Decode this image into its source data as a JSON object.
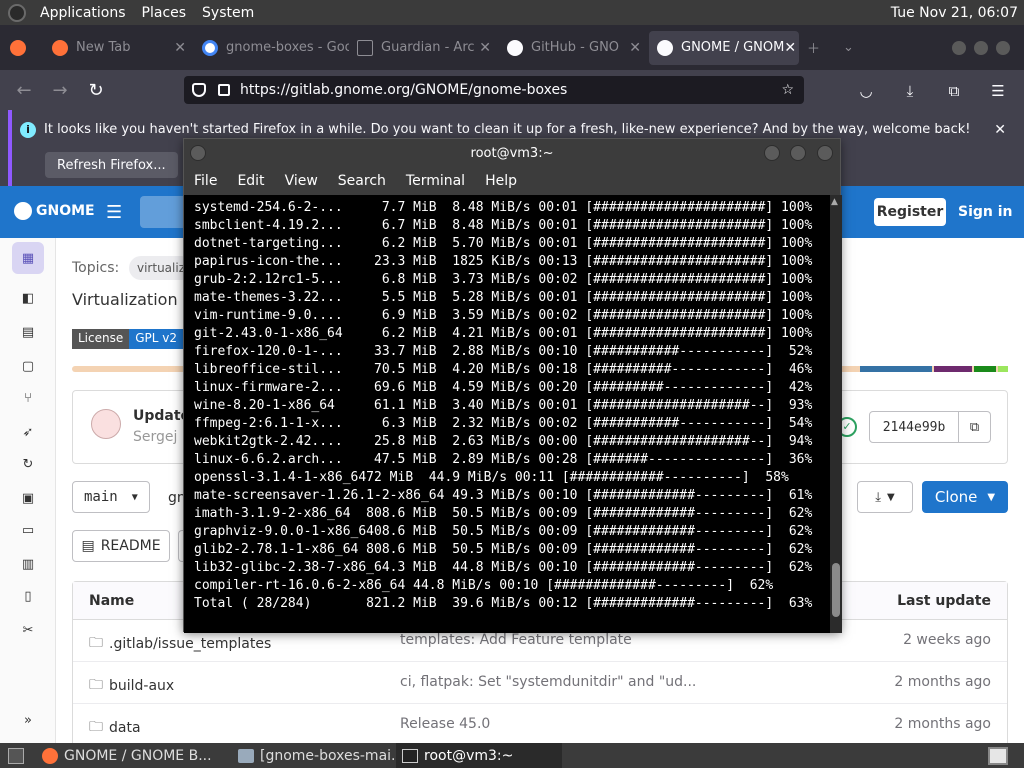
{
  "top_panel": {
    "menus": [
      "Applications",
      "Places",
      "System"
    ],
    "clock": "Tue Nov 21, 06:07"
  },
  "browser": {
    "tabs": [
      {
        "title": "New Tab",
        "active": false
      },
      {
        "title": "gnome-boxes - Goo",
        "active": false
      },
      {
        "title": "Guardian - Arc",
        "active": false
      },
      {
        "title": "GitHub - GNO",
        "active": false
      },
      {
        "title": "GNOME / GNOM",
        "active": true
      }
    ],
    "url": "https://gitlab.gnome.org/GNOME/gnome-boxes",
    "notification": {
      "message": "It looks like you haven't started Firefox in a while. Do you want to clean it up for a fresh, like-new experience? And by the way, welcome back!",
      "button": "Refresh Firefox..."
    }
  },
  "gitlab": {
    "logo_text": "GNOME",
    "register": "Register",
    "sign_in": "Sign in",
    "topics_label": "Topics:",
    "topic_chip": "virtualiz",
    "description": "Virtualization m",
    "license": {
      "label": "License",
      "value": "GPL v2"
    },
    "commit": {
      "title": "Update",
      "author": "Sergej",
      "sha": "2144e99b"
    },
    "branch": "main",
    "path_fragment": "gn",
    "clone_label": "Clone",
    "readme_label": "README",
    "file_table": {
      "col_name": "Name",
      "col_updated": "Last update",
      "rows": [
        {
          "name": ".gitlab/issue_templates",
          "commit": "templates: Add Feature template",
          "updated": "2 weeks ago"
        },
        {
          "name": "build-aux",
          "commit": "ci, flatpak: Set \"systemdunitdir\" and \"ud...",
          "updated": "2 months ago"
        },
        {
          "name": "data",
          "commit": "Release 45.0",
          "updated": "2 months ago"
        }
      ]
    },
    "colors": {
      "header": "#1f75cb",
      "clone": "#1f75cb"
    }
  },
  "terminal": {
    "title": "root@vm3:~",
    "menu": [
      "File",
      "Edit",
      "View",
      "Search",
      "Terminal",
      "Help"
    ],
    "lines": [
      "systemd-254.6-2-...     7.7 MiB  8.48 MiB/s 00:01 [######################] 100%",
      "smbclient-4.19.2...     6.7 MiB  8.48 MiB/s 00:01 [######################] 100%",
      "dotnet-targeting...     6.2 MiB  5.70 MiB/s 00:01 [######################] 100%",
      "papirus-icon-the...    23.3 MiB  1825 KiB/s 00:13 [######################] 100%",
      "grub-2:2.12rc1-5...     6.8 MiB  3.73 MiB/s 00:02 [######################] 100%",
      "mate-themes-3.22...     5.5 MiB  5.28 MiB/s 00:01 [######################] 100%",
      "vim-runtime-9.0....     6.9 MiB  3.59 MiB/s 00:02 [######################] 100%",
      "git-2.43.0-1-x86_64     6.2 MiB  4.21 MiB/s 00:01 [######################] 100%",
      "firefox-120.0-1-...    33.7 MiB  2.88 MiB/s 00:10 [###########-----------]  52%",
      "libreoffice-stil...    70.5 MiB  4.20 MiB/s 00:18 [##########------------]  46%",
      "linux-firmware-2...    69.6 MiB  4.59 MiB/s 00:20 [#########-------------]  42%",
      "wine-8.20-1-x86_64     61.1 MiB  3.40 MiB/s 00:01 [####################--]  93%",
      "ffmpeg-2:6.1-1-x...     6.3 MiB  2.32 MiB/s 00:02 [###########-----------]  54%",
      "webkit2gtk-2.42....    25.8 MiB  2.63 MiB/s 00:00 [####################--]  94%",
      "linux-6.6.2.arch...    47.5 MiB  2.89 MiB/s 00:28 [#######---------------]  36%",
      "openssl-3.1.4-1-x86_6472 MiB  44.9 MiB/s 00:11 [############----------]  58%",
      "mate-screensaver-1.26.1-2-x86_64 49.3 MiB/s 00:10 [#############---------]  61%",
      "imath-3.1.9-2-x86_64  808.6 MiB  50.5 MiB/s 00:09 [#############---------]  62%",
      "graphviz-9.0.0-1-x86_6408.6 MiB  50.5 MiB/s 00:09 [#############---------]  62%",
      "glib2-2.78.1-1-x86_64 808.6 MiB  50.5 MiB/s 00:09 [#############---------]  62%",
      "lib32-glibc-2.38-7-x86_64.3 MiB  44.8 MiB/s 00:10 [#############---------]  62%",
      "compiler-rt-16.0.6-2-x86_64 44.8 MiB/s 00:10 [#############---------]  62%",
      "Total ( 28/284)       821.2 MiB  39.6 MiB/s 00:12 [#############---------]  63%"
    ]
  },
  "taskbar": {
    "items": [
      {
        "label": "GNOME / GNOME B...",
        "active": false
      },
      {
        "label": "[gnome-boxes-mai...",
        "active": false
      },
      {
        "label": "root@vm3:~",
        "active": true
      }
    ]
  }
}
